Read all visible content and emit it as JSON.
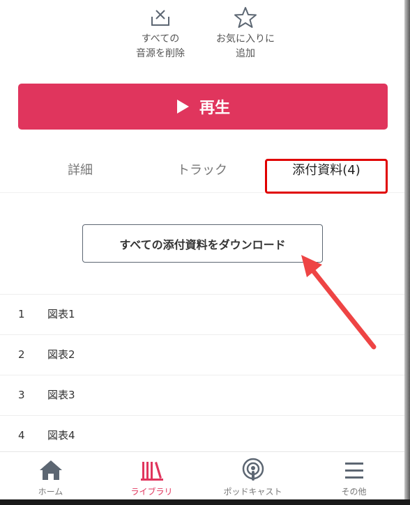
{
  "actions": [
    {
      "icon": "delete-download-icon",
      "label_line1": "すべての",
      "label_line2": "音源を削除"
    },
    {
      "icon": "star-icon",
      "label_line1": "お気に入りに",
      "label_line2": "追加"
    }
  ],
  "play_button": {
    "label": "再生"
  },
  "tabs": [
    {
      "label": "詳細"
    },
    {
      "label": "トラック"
    },
    {
      "label": "添付資料(4)"
    }
  ],
  "download_all": {
    "label": "すべての添付資料をダウンロード"
  },
  "attachments": [
    {
      "num": "1",
      "name": "図表1"
    },
    {
      "num": "2",
      "name": "図表2"
    },
    {
      "num": "3",
      "name": "図表3"
    },
    {
      "num": "4",
      "name": "図表4"
    }
  ],
  "nav": [
    {
      "label": "ホーム",
      "icon": "home-icon"
    },
    {
      "label": "ライブラリ",
      "icon": "library-icon"
    },
    {
      "label": "ポッドキャスト",
      "icon": "podcast-icon"
    },
    {
      "label": "その他",
      "icon": "menu-icon"
    }
  ],
  "colors": {
    "accent": "#e0355d",
    "highlight": "#e00000",
    "annotation_arrow": "#ee4444"
  }
}
